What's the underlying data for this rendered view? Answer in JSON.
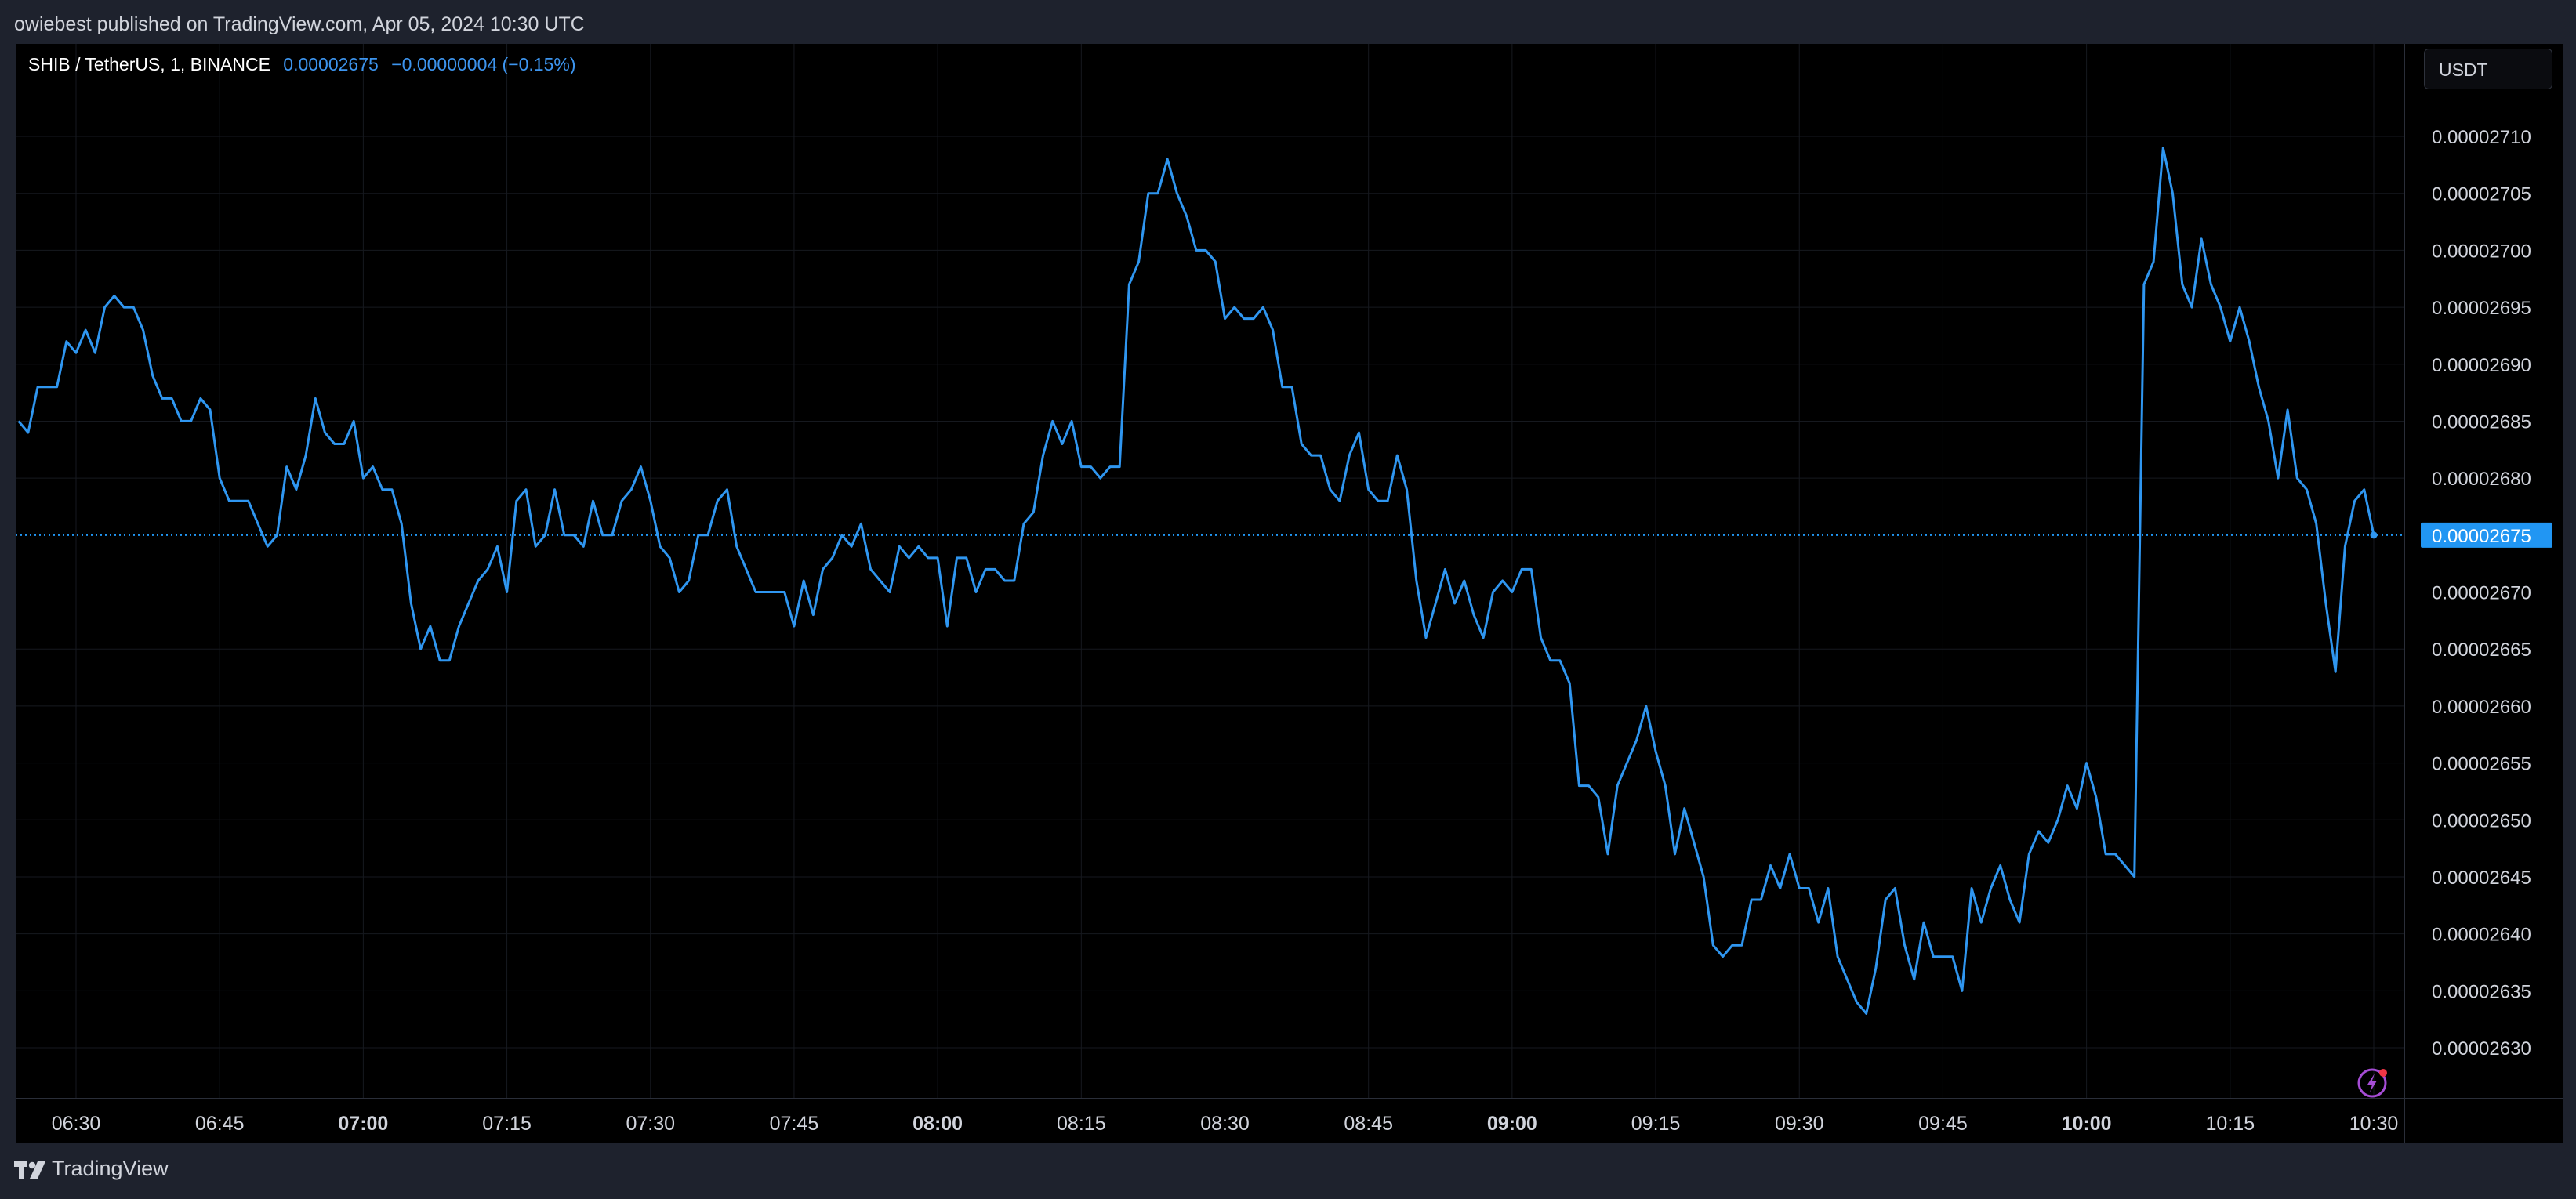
{
  "header": {
    "published_text": "owiebest published on TradingView.com, Apr 05, 2024 10:30 UTC"
  },
  "legend": {
    "symbol": "SHIB / TetherUS, 1, BINANCE",
    "last": "0.00002675",
    "change": "−0.00000004 (−0.15%)"
  },
  "currency_button": "USDT",
  "footer": {
    "brand": "TradingView"
  },
  "colors": {
    "line": "#2f96f0",
    "price_tag": "#2196f3",
    "grid": "#16191f",
    "background": "#000000",
    "panel": "#1e222d"
  },
  "icons": [
    "tradingview-logo-icon",
    "flash-icon"
  ],
  "chart_data": {
    "type": "line",
    "title": "",
    "xlabel": "",
    "ylabel": "",
    "ylim": [
      2.625e-05,
      2.714e-05
    ],
    "x_ticks": [
      {
        "label": "06:30",
        "t": 390
      },
      {
        "label": "06:45",
        "t": 405
      },
      {
        "label": "07:00",
        "t": 420,
        "bold": true
      },
      {
        "label": "07:15",
        "t": 435
      },
      {
        "label": "07:30",
        "t": 450
      },
      {
        "label": "07:45",
        "t": 465
      },
      {
        "label": "08:00",
        "t": 480,
        "bold": true
      },
      {
        "label": "08:15",
        "t": 495
      },
      {
        "label": "08:30",
        "t": 510
      },
      {
        "label": "08:45",
        "t": 525
      },
      {
        "label": "09:00",
        "t": 540,
        "bold": true
      },
      {
        "label": "09:15",
        "t": 555
      },
      {
        "label": "09:30",
        "t": 570
      },
      {
        "label": "09:45",
        "t": 585
      },
      {
        "label": "10:00",
        "t": 600,
        "bold": true
      },
      {
        "label": "10:15",
        "t": 615
      },
      {
        "label": "10:30",
        "t": 630
      }
    ],
    "y_ticks": [
      "0.00002710",
      "0.00002705",
      "0.00002700",
      "0.00002695",
      "0.00002690",
      "0.00002685",
      "0.00002680",
      "0.00002670",
      "0.00002665",
      "0.00002660",
      "0.00002655",
      "0.00002650",
      "0.00002645",
      "0.00002640",
      "0.00002635",
      "0.00002630"
    ],
    "last_price": "0.00002675",
    "x_unit": "minutes since 00:00 UTC",
    "series": [
      {
        "x": [
          384,
          385,
          386,
          387,
          388,
          389,
          390,
          391,
          392,
          393,
          394,
          395,
          396,
          397,
          398,
          399,
          400,
          401,
          402,
          403,
          404,
          405,
          406,
          407,
          408,
          409,
          410,
          411,
          412,
          413,
          414,
          415,
          416,
          417,
          418,
          419,
          420,
          421,
          422,
          423,
          424,
          425,
          426,
          427,
          428,
          429,
          430,
          431,
          432,
          433,
          434,
          435,
          436,
          437,
          438,
          439,
          440,
          441,
          442,
          443,
          444,
          445,
          446,
          447,
          448,
          449,
          450,
          451,
          452,
          453,
          454,
          455,
          456,
          457,
          458,
          459,
          460,
          461,
          462,
          463,
          464,
          465,
          466,
          467,
          468,
          469,
          470,
          471,
          472,
          473,
          474,
          475,
          476,
          477,
          478,
          479,
          480,
          481,
          482,
          483,
          484,
          485,
          486,
          487,
          488,
          489,
          490,
          491,
          492,
          493,
          494,
          495,
          496,
          497,
          498,
          499,
          500,
          501,
          502,
          503,
          504,
          505,
          506,
          507,
          508,
          509,
          510,
          511,
          512,
          513,
          514,
          515,
          516,
          517,
          518,
          519,
          520,
          521,
          522,
          523,
          524,
          525,
          526,
          527,
          528,
          529,
          530,
          531,
          532,
          533,
          534,
          535,
          536,
          537,
          538,
          539,
          540,
          541,
          542,
          543,
          544,
          545,
          546,
          547,
          548,
          549,
          550,
          551,
          552,
          553,
          554,
          555,
          556,
          557,
          558,
          559,
          560,
          561,
          562,
          563,
          564,
          565,
          566,
          567,
          568,
          569,
          570,
          571,
          572,
          573,
          574,
          575,
          576,
          577,
          578,
          579,
          580,
          581,
          582,
          583,
          584,
          585,
          586,
          587,
          588,
          589,
          590,
          591,
          592,
          593,
          594,
          595,
          596,
          597,
          598,
          599,
          600,
          601,
          602,
          603,
          604,
          605,
          606,
          607,
          608,
          609,
          610,
          611,
          612,
          613,
          614,
          615,
          616,
          617,
          618,
          619,
          620,
          621,
          622,
          623,
          624,
          625,
          626,
          627,
          628,
          629,
          630
        ],
        "values": [
          2.685e-05,
          2.684e-05,
          2.688e-05,
          2.688e-05,
          2.688e-05,
          2.692e-05,
          2.691e-05,
          2.693e-05,
          2.691e-05,
          2.695e-05,
          2.696e-05,
          2.695e-05,
          2.695e-05,
          2.693e-05,
          2.689e-05,
          2.687e-05,
          2.687e-05,
          2.685e-05,
          2.685e-05,
          2.687e-05,
          2.686e-05,
          2.68e-05,
          2.678e-05,
          2.678e-05,
          2.678e-05,
          2.676e-05,
          2.674e-05,
          2.675e-05,
          2.681e-05,
          2.679e-05,
          2.682e-05,
          2.687e-05,
          2.684e-05,
          2.683e-05,
          2.683e-05,
          2.685e-05,
          2.68e-05,
          2.681e-05,
          2.679e-05,
          2.679e-05,
          2.676e-05,
          2.669e-05,
          2.665e-05,
          2.667e-05,
          2.664e-05,
          2.664e-05,
          2.667e-05,
          2.669e-05,
          2.671e-05,
          2.672e-05,
          2.674e-05,
          2.67e-05,
          2.678e-05,
          2.679e-05,
          2.674e-05,
          2.675e-05,
          2.679e-05,
          2.675e-05,
          2.675e-05,
          2.674e-05,
          2.678e-05,
          2.675e-05,
          2.675e-05,
          2.678e-05,
          2.679e-05,
          2.681e-05,
          2.678e-05,
          2.674e-05,
          2.673e-05,
          2.67e-05,
          2.671e-05,
          2.675e-05,
          2.675e-05,
          2.678e-05,
          2.679e-05,
          2.674e-05,
          2.672e-05,
          2.67e-05,
          2.67e-05,
          2.67e-05,
          2.67e-05,
          2.667e-05,
          2.671e-05,
          2.668e-05,
          2.672e-05,
          2.673e-05,
          2.675e-05,
          2.674e-05,
          2.676e-05,
          2.672e-05,
          2.671e-05,
          2.67e-05,
          2.674e-05,
          2.673e-05,
          2.674e-05,
          2.673e-05,
          2.673e-05,
          2.667e-05,
          2.673e-05,
          2.673e-05,
          2.67e-05,
          2.672e-05,
          2.672e-05,
          2.671e-05,
          2.671e-05,
          2.676e-05,
          2.677e-05,
          2.682e-05,
          2.685e-05,
          2.683e-05,
          2.685e-05,
          2.681e-05,
          2.681e-05,
          2.68e-05,
          2.681e-05,
          2.681e-05,
          2.697e-05,
          2.699e-05,
          2.705e-05,
          2.705e-05,
          2.708e-05,
          2.705e-05,
          2.703e-05,
          2.7e-05,
          2.7e-05,
          2.699e-05,
          2.694e-05,
          2.695e-05,
          2.694e-05,
          2.694e-05,
          2.695e-05,
          2.693e-05,
          2.688e-05,
          2.688e-05,
          2.683e-05,
          2.682e-05,
          2.682e-05,
          2.679e-05,
          2.678e-05,
          2.682e-05,
          2.684e-05,
          2.679e-05,
          2.678e-05,
          2.678e-05,
          2.682e-05,
          2.679e-05,
          2.671e-05,
          2.666e-05,
          2.669e-05,
          2.672e-05,
          2.669e-05,
          2.671e-05,
          2.668e-05,
          2.666e-05,
          2.67e-05,
          2.671e-05,
          2.67e-05,
          2.672e-05,
          2.672e-05,
          2.666e-05,
          2.664e-05,
          2.664e-05,
          2.662e-05,
          2.653e-05,
          2.653e-05,
          2.652e-05,
          2.647e-05,
          2.653e-05,
          2.655e-05,
          2.657e-05,
          2.66e-05,
          2.656e-05,
          2.653e-05,
          2.647e-05,
          2.651e-05,
          2.648e-05,
          2.645e-05,
          2.639e-05,
          2.638e-05,
          2.639e-05,
          2.639e-05,
          2.643e-05,
          2.643e-05,
          2.646e-05,
          2.644e-05,
          2.647e-05,
          2.644e-05,
          2.644e-05,
          2.641e-05,
          2.644e-05,
          2.638e-05,
          2.636e-05,
          2.634e-05,
          2.633e-05,
          2.637e-05,
          2.643e-05,
          2.644e-05,
          2.639e-05,
          2.636e-05,
          2.641e-05,
          2.638e-05,
          2.638e-05,
          2.638e-05,
          2.635e-05,
          2.644e-05,
          2.641e-05,
          2.644e-05,
          2.646e-05,
          2.643e-05,
          2.641e-05,
          2.647e-05,
          2.649e-05,
          2.648e-05,
          2.65e-05,
          2.653e-05,
          2.651e-05,
          2.655e-05,
          2.652e-05,
          2.647e-05,
          2.647e-05,
          2.646e-05,
          2.645e-05,
          2.697e-05,
          2.699e-05,
          2.709e-05,
          2.705e-05,
          2.697e-05,
          2.695e-05,
          2.701e-05,
          2.697e-05,
          2.695e-05,
          2.692e-05,
          2.695e-05,
          2.692e-05,
          2.688e-05,
          2.685e-05,
          2.68e-05,
          2.686e-05,
          2.68e-05,
          2.679e-05,
          2.676e-05,
          2.669e-05,
          2.663e-05,
          2.674e-05,
          2.678e-05,
          2.679e-05,
          2.675e-05
        ]
      }
    ]
  }
}
